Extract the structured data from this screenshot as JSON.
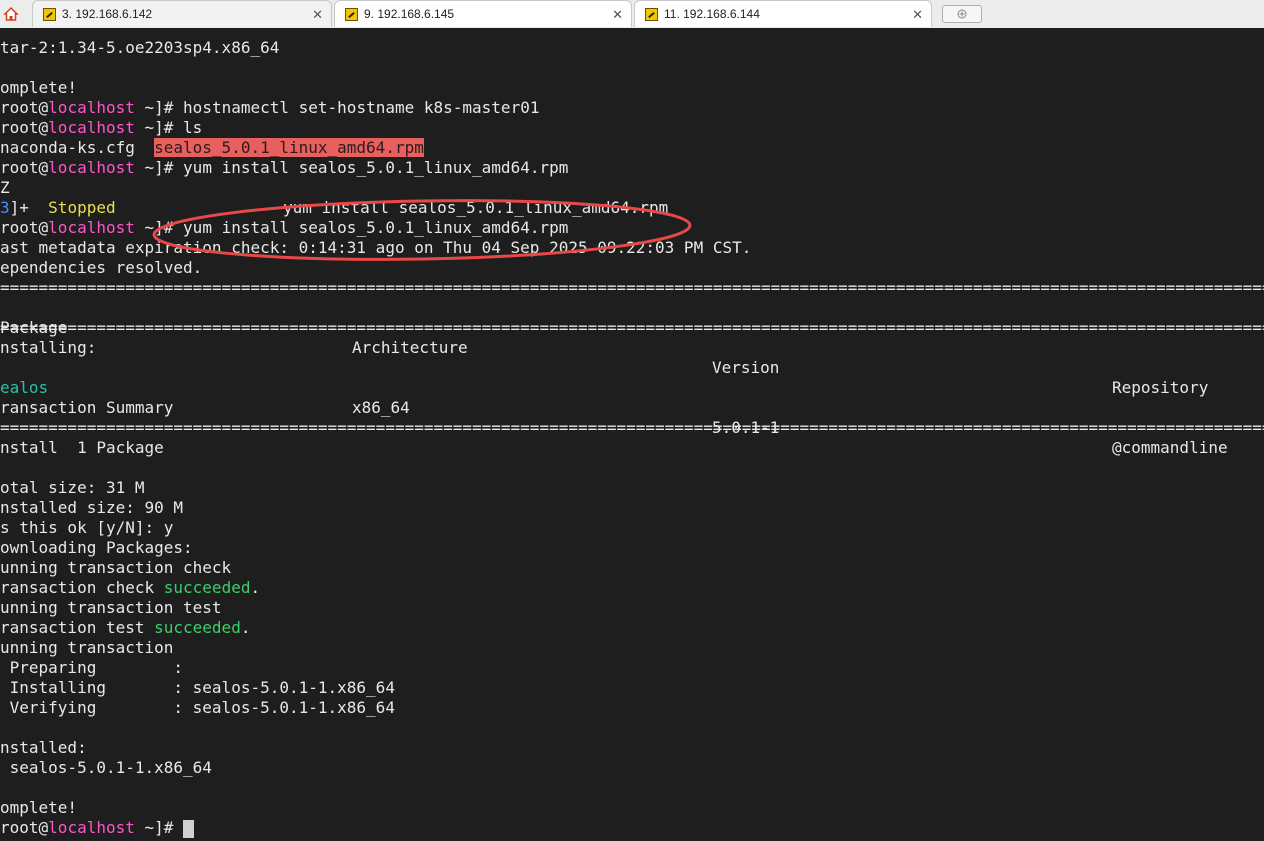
{
  "tabs": [
    {
      "label": "3. 192.168.6.142",
      "active": true
    },
    {
      "label": "9. 192.168.6.145",
      "active": false
    },
    {
      "label": "11. 192.168.6.144",
      "active": false
    }
  ],
  "prompt": {
    "user": "root@",
    "host": "localhost",
    "rest": " ~]# "
  },
  "terminal": {
    "l1": "tar-2:1.34-5.oe2203sp4.x86_64",
    "l2": "omplete!",
    "cmd_hostname": "hostnamectl set-hostname k8s-master01",
    "cmd_ls": "ls",
    "ls_file1": "naconda-ks.cfg",
    "ls_file2": "sealos_5.0.1_linux_amd64.rpm",
    "cmd_yum1": "yum install sealos_5.0.1_linux_amd64.rpm",
    "ctrl_z": "Z",
    "job_bracket": "3",
    "job_close": "]+",
    "job_status": "Stopped",
    "job_cmd": "yum install sealos_5.0.1_linux_amd64.rpm",
    "cmd_yum2": "yum install sealos_5.0.1_linux_amd64.rpm",
    "metadata": "ast metadata expiration check: 0:14:31 ago on Thu 04 Sep 2025 09:22:03 PM CST.",
    "resolved": "ependencies resolved.",
    "separator": "=================================================================================================================================================",
    "headers": {
      "package": "Package",
      "arch": "Architecture",
      "version": "Version",
      "repo": "Repository"
    },
    "installing_label": "nstalling:",
    "row": {
      "name": "ealos",
      "arch": "x86_64",
      "version": "5.0.1-1",
      "repo": "@commandline"
    },
    "summary_label": "ransaction Summary",
    "install_count": "nstall  1 Package",
    "total_size": "otal size: 31 M",
    "installed_size": "nstalled size: 90 M",
    "is_ok": "s this ok [y/N]: y",
    "downloading": "ownloading Packages:",
    "run_check": "unning transaction check",
    "check_prefix": "ransaction check ",
    "succeeded": "succeeded",
    "dot": ".",
    "run_test": "unning transaction test",
    "test_prefix": "ransaction test ",
    "run_tx": "unning transaction",
    "preparing": " Preparing        :",
    "installing_step": " Installing       : sealos-5.0.1-1.x86_64",
    "verifying_step": " Verifying        : sealos-5.0.1-1.x86_64",
    "installed_label": "nstalled:",
    "installed_pkg": " sealos-5.0.1-1.x86_64",
    "complete": "omplete!"
  },
  "colors": {
    "prompt_host": "#ff55cc",
    "success": "#3ad06a",
    "highlight": "#e8605e",
    "annotation": "#e84848"
  }
}
